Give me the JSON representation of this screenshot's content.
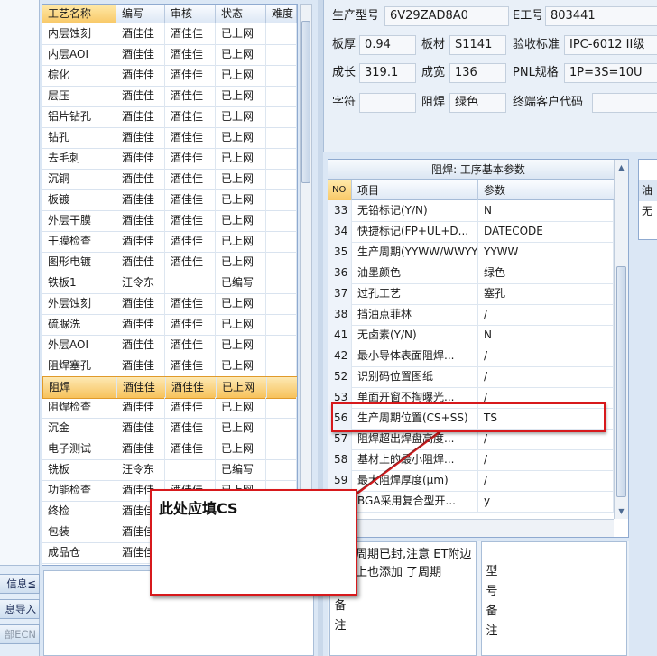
{
  "side_buttons": [
    {
      "label": "信息≦",
      "disabled": false
    },
    {
      "label": "息导入",
      "disabled": false
    },
    {
      "label": "部ECN",
      "disabled": true
    }
  ],
  "process_grid": {
    "columns": [
      "工艺名称",
      "编写",
      "审核",
      "状态",
      "难度"
    ],
    "rows": [
      [
        "内层蚀刻",
        "酒佳佳",
        "酒佳佳",
        "已上网",
        ""
      ],
      [
        "内层AOI",
        "酒佳佳",
        "酒佳佳",
        "已上网",
        ""
      ],
      [
        "棕化",
        "酒佳佳",
        "酒佳佳",
        "已上网",
        ""
      ],
      [
        "层压",
        "酒佳佳",
        "酒佳佳",
        "已上网",
        ""
      ],
      [
        "铝片钻孔",
        "酒佳佳",
        "酒佳佳",
        "已上网",
        ""
      ],
      [
        "钻孔",
        "酒佳佳",
        "酒佳佳",
        "已上网",
        ""
      ],
      [
        "去毛刺",
        "酒佳佳",
        "酒佳佳",
        "已上网",
        ""
      ],
      [
        "沉铜",
        "酒佳佳",
        "酒佳佳",
        "已上网",
        ""
      ],
      [
        "板镀",
        "酒佳佳",
        "酒佳佳",
        "已上网",
        ""
      ],
      [
        "外层干膜",
        "酒佳佳",
        "酒佳佳",
        "已上网",
        ""
      ],
      [
        "干膜检查",
        "酒佳佳",
        "酒佳佳",
        "已上网",
        ""
      ],
      [
        "图形电镀",
        "酒佳佳",
        "酒佳佳",
        "已上网",
        ""
      ],
      [
        "铁板1",
        "汪令东",
        "",
        "已编写",
        ""
      ],
      [
        "外层蚀刻",
        "酒佳佳",
        "酒佳佳",
        "已上网",
        ""
      ],
      [
        "硫脲洗",
        "酒佳佳",
        "酒佳佳",
        "已上网",
        ""
      ],
      [
        "外层AOI",
        "酒佳佳",
        "酒佳佳",
        "已上网",
        ""
      ],
      [
        "阻焊塞孔",
        "酒佳佳",
        "酒佳佳",
        "已上网",
        ""
      ],
      [
        "阻焊",
        "酒佳佳",
        "酒佳佳",
        "已上网",
        ""
      ],
      [
        "阻焊检查",
        "酒佳佳",
        "酒佳佳",
        "已上网",
        ""
      ],
      [
        "沉金",
        "酒佳佳",
        "酒佳佳",
        "已上网",
        ""
      ],
      [
        "电子测试",
        "酒佳佳",
        "酒佳佳",
        "已上网",
        ""
      ],
      [
        "铣板",
        "汪令东",
        "",
        "已编写",
        ""
      ],
      [
        "功能检查",
        "酒佳佳",
        "酒佳佳",
        "已上网",
        ""
      ],
      [
        "终检",
        "酒佳佳",
        "",
        "",
        ""
      ],
      [
        "包装",
        "酒佳佳",
        "",
        "",
        ""
      ],
      [
        "成品仓",
        "酒佳佳",
        "",
        "",
        ""
      ]
    ],
    "selected_index": 17
  },
  "info": {
    "model_label": "生产型号",
    "model_value": "6V29ZAD8A0",
    "emp_label": "E工号",
    "emp_value": "803441",
    "thickness_label": "板厚",
    "thickness_value": "0.94",
    "material_label": "板材",
    "material_value": "S1141",
    "standard_label": "验收标准",
    "standard_value": "IPC-6012 II级",
    "growth_label": "成长",
    "growth_value": "319.1",
    "yield_label": "成宽",
    "yield_value": "136",
    "pnl_label": "PNL规格",
    "pnl_value": "1P=3S=10U",
    "char_label": "字符",
    "char_value": "",
    "mask_label": "阻焊",
    "mask_value": "绿色",
    "customer_label": "终端客户代码",
    "customer_value": ""
  },
  "params": {
    "title": "阻焊: 工序基本参数",
    "columns": [
      "NO",
      "项目",
      "参数"
    ],
    "rows": [
      [
        "33",
        "无铅标记(Y/N)",
        "N"
      ],
      [
        "34",
        "快捷标记(FP+UL+D...",
        "DATECODE"
      ],
      [
        "35",
        "生产周期(YYWW/WWYY)",
        "YYWW"
      ],
      [
        "36",
        "油墨颜色",
        "绿色"
      ],
      [
        "37",
        "过孔工艺",
        "塞孔"
      ],
      [
        "38",
        "挡油点菲林",
        "/"
      ],
      [
        "41",
        "无卤素(Y/N)",
        "N"
      ],
      [
        "42",
        "最小导体表面阻焊...",
        "/"
      ],
      [
        "52",
        "识别码位置图纸",
        "/"
      ],
      [
        "53",
        "单面开窗不掏曝光...",
        "/"
      ],
      [
        "56",
        "生产周期位置(CS+SS)",
        "TS"
      ],
      [
        "57",
        "阻焊超出焊盘高度...",
        "/"
      ],
      [
        "58",
        "基材上的最小阻焊...",
        "/"
      ],
      [
        "59",
        "最大阻焊厚度(µm)",
        "/"
      ],
      [
        "60",
        "BGA采用复合型开...",
        "y"
      ]
    ]
  },
  "right_partial": [
    "油",
    "无"
  ],
  "remarks": {
    "label1": "备注",
    "text1": "周期已封,注意 ET附边上也添加 了周期",
    "label2": "型号备注"
  },
  "annotation": {
    "callout_text": "此处应填CS",
    "line_color": "#d7191c"
  }
}
